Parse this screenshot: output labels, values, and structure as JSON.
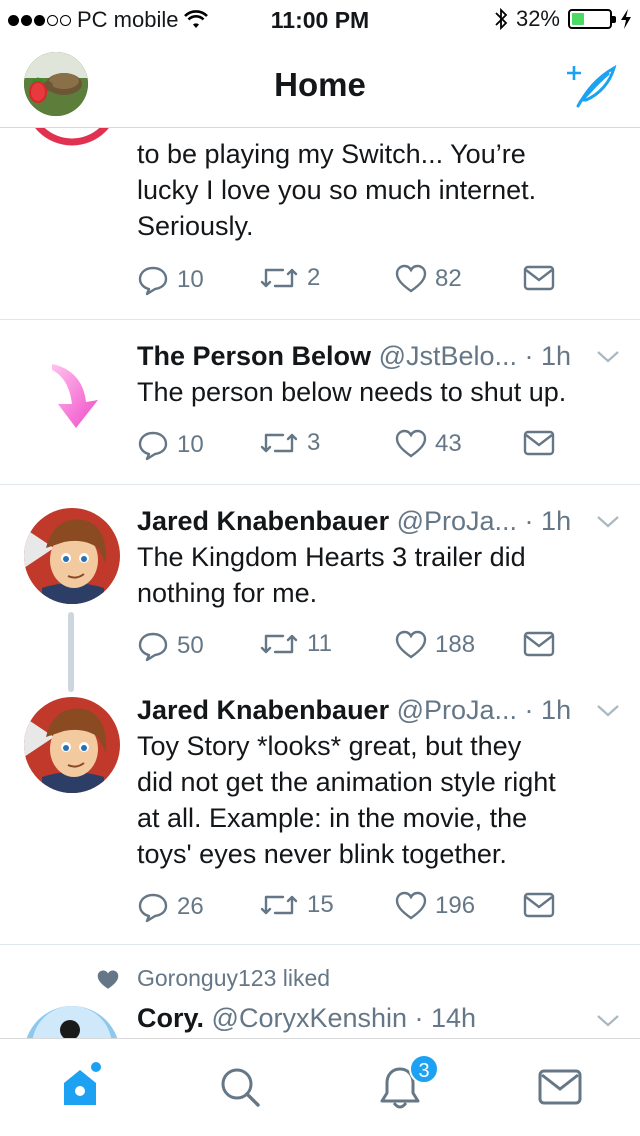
{
  "status_bar": {
    "carrier": "PC mobile",
    "time": "11:00 PM",
    "battery": "32%",
    "battery_level": 0.32
  },
  "header": {
    "title": "Home"
  },
  "tweets": [
    {
      "text_lines": [
        "to be playing my Switch... You’re",
        "lucky I love you so much internet.",
        "Seriously."
      ],
      "replies": "10",
      "retweets": "2",
      "likes": "82"
    },
    {
      "name": "The Person Below",
      "handle": "@JstBelo... · 1h",
      "text": "The person below needs to shut up.",
      "replies": "10",
      "retweets": "3",
      "likes": "43"
    },
    {
      "name": "Jared Knabenbauer",
      "handle": "@ProJa... · 1h",
      "text_lines": [
        "The Kingdom Hearts 3 trailer did",
        "nothing for me."
      ],
      "replies": "50",
      "retweets": "11",
      "likes": "188"
    },
    {
      "name": "Jared Knabenbauer",
      "handle": "@ProJa... · 1h",
      "text_lines": [
        "Toy Story *looks* great, but they",
        "did not get the animation style right",
        "at all. Example: in the movie, the",
        "toys' eyes never blink together."
      ],
      "replies": "26",
      "retweets": "15",
      "likes": "196"
    },
    {
      "liked_by": "Goronguy123 liked",
      "name": "Cory.",
      "handle": "@CoryxKenshin · 14h"
    }
  ],
  "tabbar": {
    "notification_count": "3"
  },
  "colors": {
    "accent": "#1da1f2",
    "text": "#14171a",
    "muted": "#657786"
  }
}
